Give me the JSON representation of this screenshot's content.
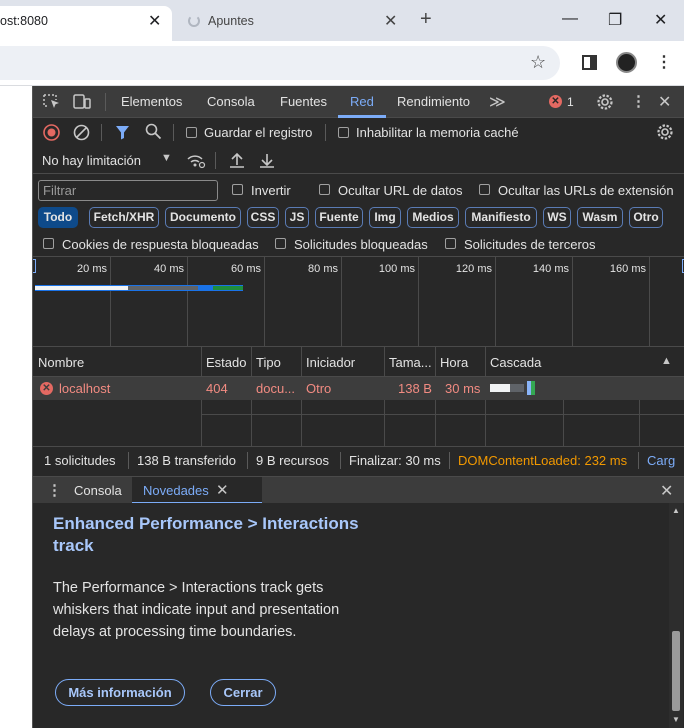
{
  "browser": {
    "active_tab_title": "ost:8080",
    "inactive_tab_title": "Apuntes"
  },
  "devtools": {
    "tabs": [
      "Elementos",
      "Consola",
      "Fuentes",
      "Red",
      "Rendimiento"
    ],
    "active_tab": "Red",
    "error_count": "1",
    "network": {
      "preserve_log": "Guardar el registro",
      "disable_cache": "Inhabilitar la memoria caché",
      "throttling": "No hay limitación",
      "filter_placeholder": "Filtrar",
      "invert": "Invertir",
      "hide_data_urls": "Ocultar URL de datos",
      "hide_extension_urls": "Ocultar las URLs de extensión",
      "type_filters": [
        "Todo",
        "Fetch/XHR",
        "Documento",
        "CSS",
        "JS",
        "Fuente",
        "Img",
        "Medios",
        "Manifiesto",
        "WS",
        "Wasm",
        "Otro"
      ],
      "blocked_cookies": "Cookies de respuesta bloqueadas",
      "blocked_requests": "Solicitudes bloqueadas",
      "third_party": "Solicitudes de terceros",
      "overview_ticks": [
        "20 ms",
        "40 ms",
        "60 ms",
        "80 ms",
        "100 ms",
        "120 ms",
        "140 ms",
        "160 ms"
      ],
      "columns": [
        "Nombre",
        "Estado",
        "Tipo",
        "Iniciador",
        "Tama...",
        "Hora",
        "Cascada"
      ],
      "requests": [
        {
          "name": "localhost",
          "status": "404",
          "type": "docu...",
          "initiator": "Otro",
          "size": "138 B",
          "time": "30 ms"
        }
      ],
      "summary": {
        "requests": "1 solicitudes",
        "transferred": "138 B transferido",
        "resources": "9 B recursos",
        "finish": "Finalizar: 30 ms",
        "dcl": "DOMContentLoaded: 232 ms",
        "load": "Carg"
      }
    },
    "drawer": {
      "tabs": [
        "Consola",
        "Novedades"
      ],
      "active_tab": "Novedades",
      "whats_new": {
        "title": "Enhanced Performance > Interactions track",
        "body": "The Performance > Interactions track gets whiskers that indicate input and presentation delays at processing time boundaries.",
        "more_button": "Más información",
        "close_button": "Cerrar"
      }
    }
  }
}
